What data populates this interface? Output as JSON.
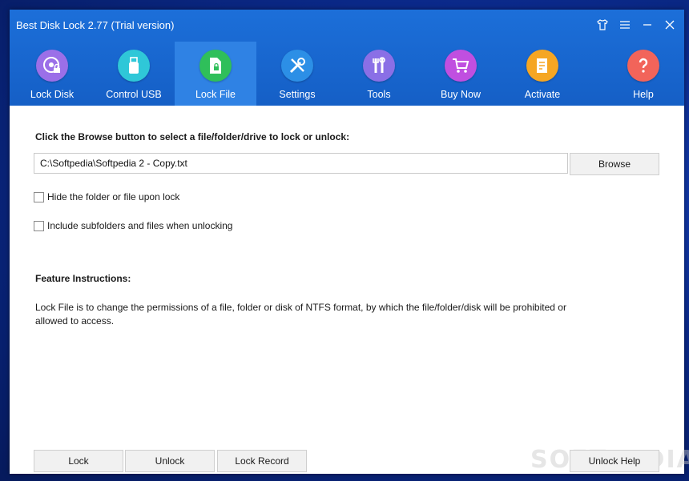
{
  "window": {
    "title": "Best Disk Lock 2.77 (Trial version)"
  },
  "nav": [
    {
      "label": "Lock Disk",
      "icon": "disk-lock-icon",
      "color": "#9b6fe8"
    },
    {
      "label": "Control USB",
      "icon": "usb-icon",
      "color": "#2fc7d8"
    },
    {
      "label": "Lock File",
      "icon": "file-lock-icon",
      "color": "#2fbf5a",
      "active": true
    },
    {
      "label": "Settings",
      "icon": "settings-icon",
      "color": "#2c8fe6"
    },
    {
      "label": "Tools",
      "icon": "tools-icon",
      "color": "#8a6fe6"
    },
    {
      "label": "Buy Now",
      "icon": "cart-icon",
      "color": "#c04fe0"
    },
    {
      "label": "Activate",
      "icon": "activate-icon",
      "color": "#f5a623"
    },
    {
      "label": "Help",
      "icon": "help-icon",
      "color": "#f2645a"
    }
  ],
  "main": {
    "instruction": "Click the Browse button to select a file/folder/drive to lock or unlock:",
    "path_value": "C:\\Softpedia\\Softpedia 2 - Copy.txt",
    "browse_label": "Browse",
    "option_hide": "Hide the folder or file upon lock",
    "option_subfolders": "Include subfolders and files when unlocking",
    "feature_title": "Feature Instructions:",
    "feature_text": "Lock File is to change the permissions of a file, folder or disk of NTFS format, by which the file/folder/disk will be prohibited or allowed to access."
  },
  "footer": {
    "lock_label": "Lock",
    "unlock_label": "Unlock",
    "record_label": "Lock Record",
    "unlock_help_label": "Unlock Help"
  },
  "watermark": "SOFTPEDIA"
}
